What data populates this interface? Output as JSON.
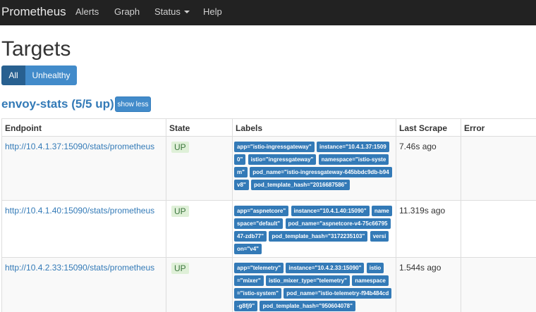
{
  "nav": {
    "brand": "Prometheus",
    "items": [
      "Alerts",
      "Graph",
      "Status",
      "Help"
    ]
  },
  "page": {
    "title": "Targets",
    "filters": [
      "All",
      "Unhealthy"
    ],
    "active_filter": "All"
  },
  "job": {
    "title": "envoy-stats (5/5 up)",
    "toggle_label": "show less"
  },
  "table": {
    "headers": [
      "Endpoint",
      "State",
      "Labels",
      "Last Scrape",
      "Error"
    ],
    "rows": [
      {
        "endpoint": "http://10.4.1.37:15090/stats/prometheus",
        "state": "UP",
        "labels": [
          "app=\"istio-ingressgateway\"",
          "instance=\"10.4.1.37:15090\"",
          "istio=\"ingressgateway\"",
          "namespace=\"istio-system\"",
          "pod_name=\"istio-ingressgateway-645bbdc9db-b94v8\"",
          "pod_template_hash=\"2016687586\""
        ],
        "last_scrape": "7.46s ago",
        "error": ""
      },
      {
        "endpoint": "http://10.4.1.40:15090/stats/prometheus",
        "state": "UP",
        "labels": [
          "app=\"aspnetcore\"",
          "instance=\"10.4.1.40:15090\"",
          "namespace=\"default\"",
          "pod_name=\"aspnetcore-v4-75c6679547-zdb77\"",
          "pod_template_hash=\"3172235103\"",
          "version=\"v4\""
        ],
        "last_scrape": "11.319s ago",
        "error": ""
      },
      {
        "endpoint": "http://10.4.2.33:15090/stats/prometheus",
        "state": "UP",
        "labels": [
          "app=\"telemetry\"",
          "instance=\"10.4.2.33:15090\"",
          "istio=\"mixer\"",
          "istio_mixer_type=\"telemetry\"",
          "namespace=\"istio-system\"",
          "pod_name=\"istio-telemetry-f94b484cd-g8fj9\"",
          "pod_template_hash=\"950604078\""
        ],
        "last_scrape": "1.544s ago",
        "error": ""
      }
    ]
  },
  "colors": {
    "navbar": "#222222",
    "link": "#337ab7",
    "label_bg": "#337ab7",
    "btn_active": "#286090",
    "btn": "#428bca",
    "up_bg": "#dff0d8",
    "up_text": "#3c763d"
  }
}
